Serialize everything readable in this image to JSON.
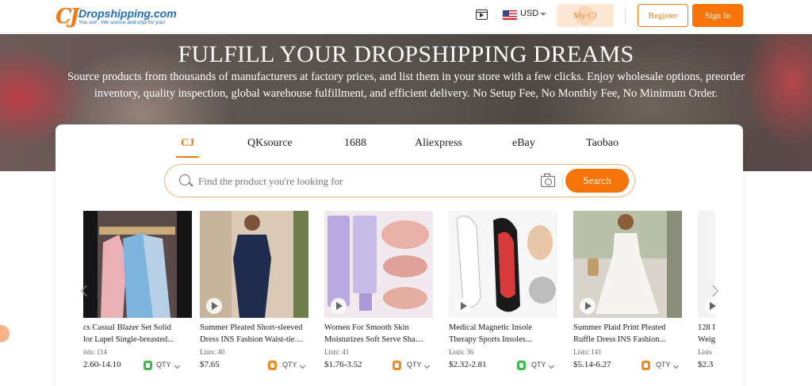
{
  "header": {
    "logo_mark": "CJ",
    "logo_name": "Dropshipping.com",
    "logo_tagline": "You sell · We source and ship for you!",
    "video_icon": "video-icon",
    "currency": "USD",
    "my_cj": "My CJ",
    "register": "Register",
    "sign_in": "Sign In"
  },
  "hero": {
    "title": "FULFILL YOUR DROPSHIPPING DREAMS",
    "subtitle": "Source products from thousands of manufacturers at factory prices, and list them in your store with a few clicks. Enjoy wholesale options, preorder inventory, quality inspection, global warehouse fulfillment, and efficient delivery. No Setup Fee, No Monthly Fee, No Minimum Order."
  },
  "search": {
    "tabs": [
      {
        "label": "CJ",
        "active": true
      },
      {
        "label": "QKsource",
        "active": false
      },
      {
        "label": "1688",
        "active": false
      },
      {
        "label": "Aliexpress",
        "active": false
      },
      {
        "label": "eBay",
        "active": false
      },
      {
        "label": "Taobao",
        "active": false
      }
    ],
    "placeholder": "Find the product you're looking for",
    "button": "Search"
  },
  "products": [
    {
      "title_line1": "cs Casual Blazer Set Solid",
      "title_line2": "lor Lapel Single-breasted...",
      "lists": "ists: 114",
      "price": "2.60-14.10",
      "badge": "green",
      "qty": "QTY"
    },
    {
      "title_line1": "Summer Pleated Short-sleeved",
      "title_line2": "Dress INS Fashion Waist-tied...",
      "lists": "Lists: 40",
      "price": "$7.65",
      "badge": "orange",
      "qty": "QTY"
    },
    {
      "title_line1": "Women For Smooth Skin",
      "title_line2": "Moisturizes Soft Serve Shave ...",
      "lists": "Lists: 41",
      "price": "$1.76-3.52",
      "badge": "orange",
      "qty": "QTY"
    },
    {
      "title_line1": "Medical Magnetic Insole",
      "title_line2": "Therapy Sports Insoles...",
      "lists": "Lists: 36",
      "price": "$2.32-2.81",
      "badge": "green",
      "qty": "QTY"
    },
    {
      "title_line1": "Summer Plaid Print Pleated",
      "title_line2": "Ruffle Dress INS Fashion...",
      "lists": "Lists: 141",
      "price": "$5.14-6.27",
      "badge": "orange",
      "qty": "QTY"
    },
    {
      "title_line1": "128 I",
      "title_line2": "Weig",
      "lists": "Lists",
      "price": "$2.3",
      "badge": "green",
      "qty": ""
    }
  ]
}
